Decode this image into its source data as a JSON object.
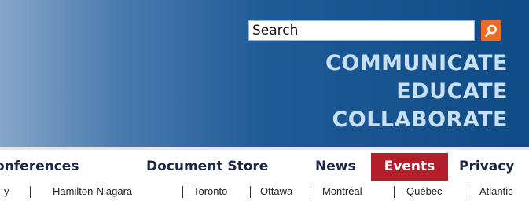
{
  "header": {
    "search_placeholder": "Search",
    "search_icon": "search-icon",
    "tagline": [
      "COMMUNICATE",
      "EDUCATE",
      "COLLABORATE"
    ]
  },
  "main_nav": {
    "items": [
      {
        "label": "onferences"
      },
      {
        "label": "Document Store"
      },
      {
        "label": "News"
      },
      {
        "label": "Events",
        "active": true
      },
      {
        "label": "Privacy"
      }
    ]
  },
  "sub_nav": {
    "items": [
      "y",
      "Hamilton-Niagara",
      "Toronto",
      "Ottawa",
      "Montréal",
      "Québec",
      "Atlantic"
    ]
  },
  "colors": {
    "active_tab": "#b21f2a",
    "search_button": "#ef6a23",
    "banner_dark": "#0f4c87",
    "tagline": "#c9dff2"
  }
}
